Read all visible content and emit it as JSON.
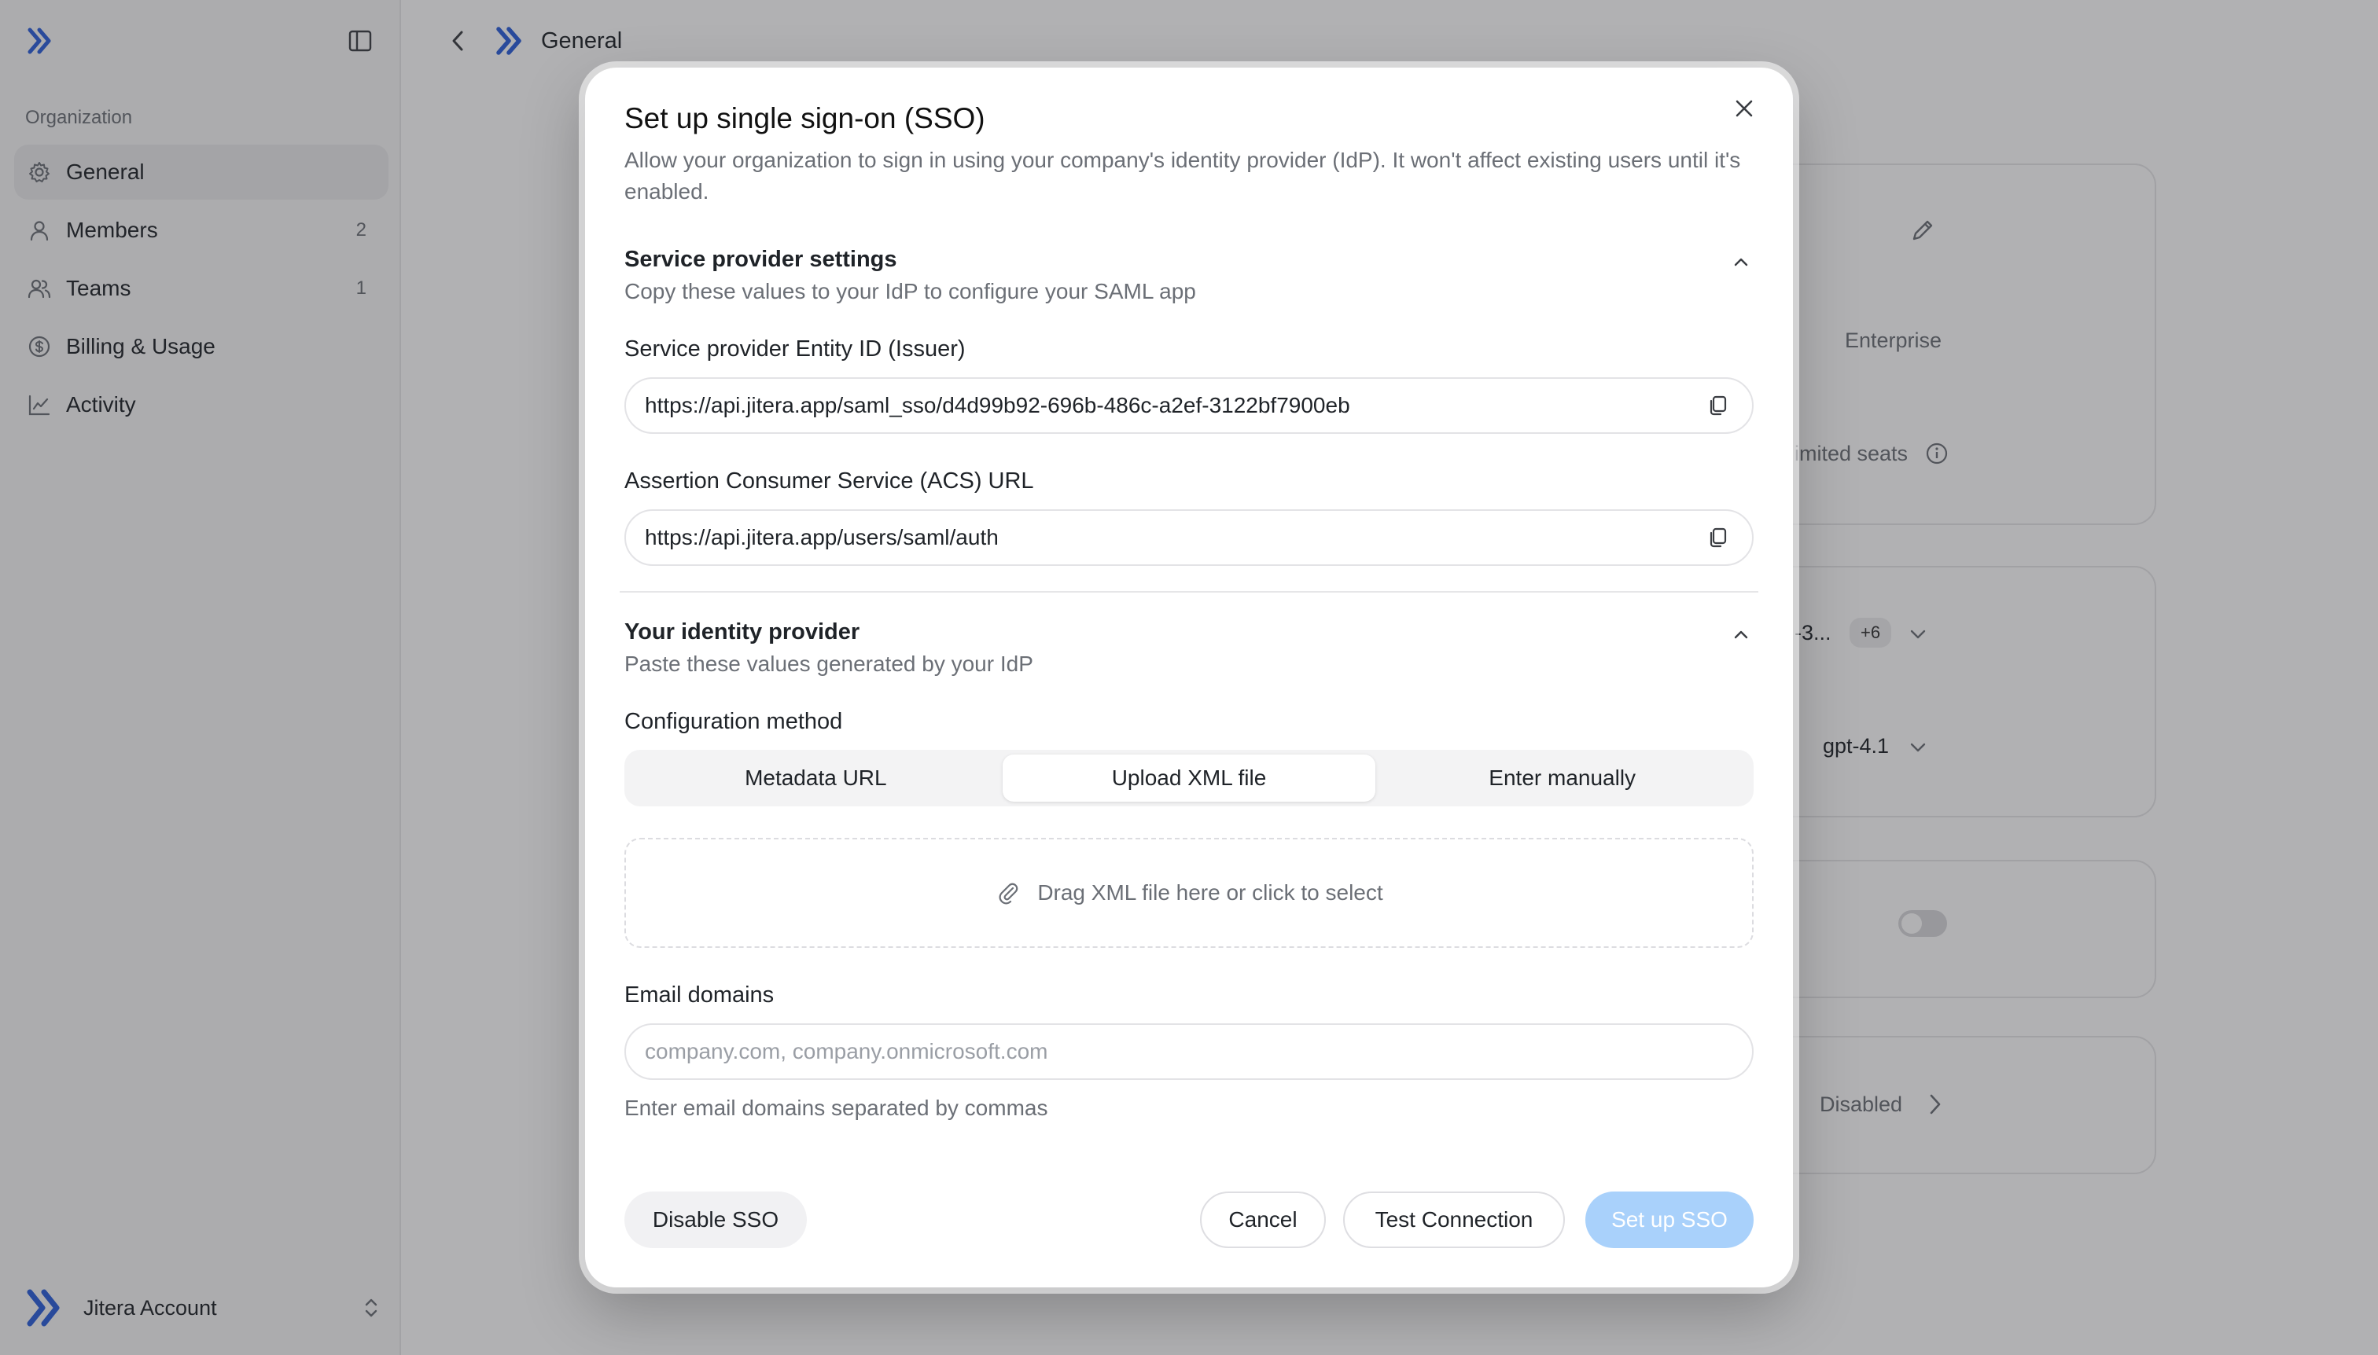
{
  "sidebar": {
    "section_label": "Organization",
    "items": [
      {
        "label": "General",
        "count": "",
        "icon": "gear-icon",
        "active": true
      },
      {
        "label": "Members",
        "count": "2",
        "icon": "user-icon",
        "active": false
      },
      {
        "label": "Teams",
        "count": "1",
        "icon": "users-icon",
        "active": false
      },
      {
        "label": "Billing & Usage",
        "count": "",
        "icon": "billing-icon",
        "active": false
      },
      {
        "label": "Activity",
        "count": "",
        "icon": "chart-line-icon",
        "active": false
      }
    ],
    "account_name": "Jitera Account"
  },
  "header": {
    "breadcrumb": "General"
  },
  "background": {
    "plan": "Enterprise",
    "seats": "imited seats",
    "models_truncated": "-3...",
    "models_more": "+6",
    "model": "gpt-4.1",
    "sso_status": "Disabled"
  },
  "modal": {
    "title": "Set up single sign-on (SSO)",
    "description": "Allow your organization to sign in using your company's identity provider (IdP). It won't affect existing users until it's enabled.",
    "sp_section": {
      "title": "Service provider settings",
      "subtitle": "Copy these values to your IdP to configure your SAML app",
      "entity_id_label": "Service provider Entity ID (Issuer)",
      "entity_id_value": "https://api.jitera.app/saml_sso/d4d99b92-696b-486c-a2ef-3122bf7900eb",
      "acs_label": "Assertion Consumer Service (ACS) URL",
      "acs_value": "https://api.jitera.app/users/saml/auth"
    },
    "idp_section": {
      "title": "Your identity provider",
      "subtitle": "Paste these values generated by your IdP",
      "config_label": "Configuration method",
      "methods": [
        "Metadata URL",
        "Upload XML file",
        "Enter manually"
      ],
      "active_method": "Upload XML file",
      "dropzone_text": "Drag XML file here or click to select",
      "email_label": "Email domains",
      "email_placeholder": "company.com, company.onmicrosoft.com",
      "email_hint": "Enter email domains separated by commas"
    },
    "buttons": {
      "disable": "Disable SSO",
      "cancel": "Cancel",
      "test": "Test Connection",
      "setup": "Set up SSO"
    }
  },
  "colors": {
    "accent": "#2b5fd9",
    "primary_disabled": "#a9d1fb",
    "overlay": "rgba(40,40,44,0.36)"
  }
}
